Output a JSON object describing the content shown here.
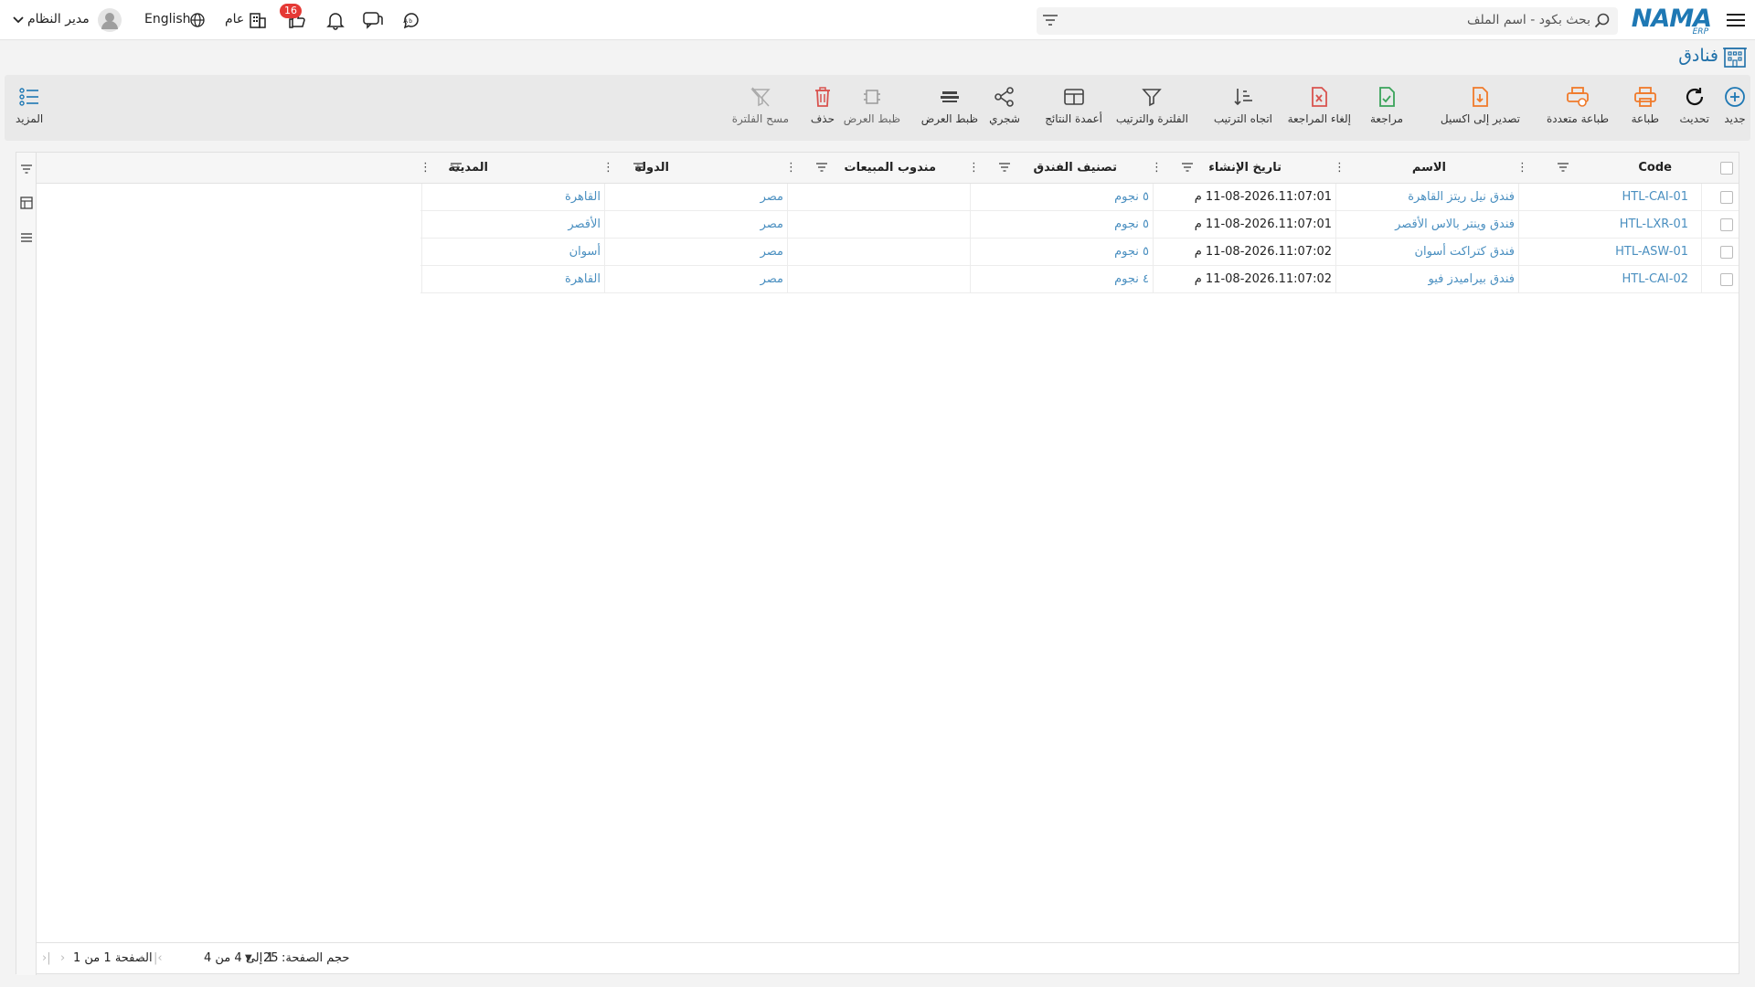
{
  "topbar": {
    "logo_text": "NAMA",
    "logo_sub": "ERP",
    "search_placeholder": "بحث بكود - اسم الملف",
    "notification_count": "16",
    "scope_label": "عام",
    "language_label": "English",
    "user_label": "مدير النظام"
  },
  "page": {
    "title": "فنادق"
  },
  "toolbar": {
    "new": "جديد",
    "refresh": "تحديث",
    "print": "طباعة",
    "multi_print": "طباعة متعددة",
    "export_excel": "تصدير إلى اكسيل",
    "review": "مراجعة",
    "cancel_review": "إلغاء المراجعة",
    "sort_direction": "اتجاه الترتيب",
    "filter_sort": "الفلترة والترتيب",
    "result_columns": "أعمدة النتائج",
    "tree": "شجري",
    "view_settings_1": "ظبط العرض",
    "view_settings_2": "ظبط العرض",
    "delete": "حذف",
    "clear_filter": "مسح الفلترة",
    "more": "المزيد"
  },
  "grid": {
    "headers": {
      "code": "Code",
      "name": "الاسم",
      "created": "تاريخ الإنشاء",
      "rating": "تصنيف الفندق",
      "sales_rep": "مندوب المبيعات",
      "country": "الدولة",
      "city": "المدينة"
    },
    "rows": [
      {
        "code": "HTL-CAI-01",
        "name": "فندق نيل ريتز القاهرة",
        "created": "11-08-2026.11:07:01 م",
        "rating": "٥ نجوم",
        "sales_rep": "",
        "country": "مصر",
        "city": "القاهرة"
      },
      {
        "code": "HTL-LXR-01",
        "name": "فندق وينتر بالاس الأقصر",
        "created": "11-08-2026.11:07:01 م",
        "rating": "٥ نجوم",
        "sales_rep": "",
        "country": "مصر",
        "city": "الأقصر"
      },
      {
        "code": "HTL-ASW-01",
        "name": "فندق كتراكت أسوان",
        "created": "11-08-2026.11:07:02 م",
        "rating": "٥ نجوم",
        "sales_rep": "",
        "country": "مصر",
        "city": "أسوان"
      },
      {
        "code": "HTL-CAI-02",
        "name": "فندق بيراميدز فيو",
        "created": "11-08-2026.11:07:02 م",
        "rating": "٤ نجوم",
        "sales_rep": "",
        "country": "مصر",
        "city": "القاهرة"
      }
    ]
  },
  "footer": {
    "page_size_label": "حجم الصفحة:",
    "page_size_value": "25",
    "range_text": "1 إلى 4 من 4",
    "page_text": "الصفحة 1 من 1"
  },
  "colors": {
    "brand": "#1e78b4",
    "link": "#4a8fc0",
    "badge": "#e53935",
    "print_orange": "#f07a2a",
    "review_green": "#3aa35a",
    "delete_red": "#d9534f"
  }
}
